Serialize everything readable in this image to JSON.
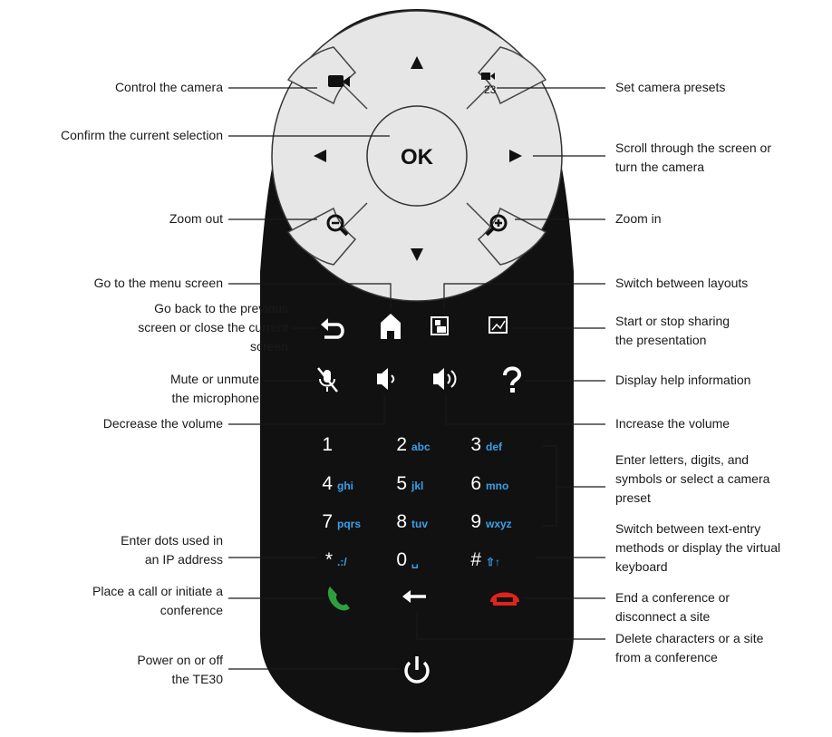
{
  "remote": {
    "ok_label": "OK",
    "power_label": "the TE30"
  },
  "keypad": {
    "keys": [
      {
        "digit": "1",
        "letters": ""
      },
      {
        "digit": "2",
        "letters": "abc"
      },
      {
        "digit": "3",
        "letters": "def"
      },
      {
        "digit": "4",
        "letters": "ghi"
      },
      {
        "digit": "5",
        "letters": "jkl"
      },
      {
        "digit": "6",
        "letters": "mno"
      },
      {
        "digit": "7",
        "letters": "pqrs"
      },
      {
        "digit": "8",
        "letters": "tuv"
      },
      {
        "digit": "9",
        "letters": "wxyz"
      },
      {
        "digit": "*",
        "letters": ".:/"
      },
      {
        "digit": "0",
        "letters": "␣"
      },
      {
        "digit": "#",
        "letters": "⇧↑"
      }
    ]
  },
  "callouts": {
    "control_camera": [
      "Control the camera"
    ],
    "confirm_selection": [
      "Confirm the current selection"
    ],
    "zoom_out": [
      "Zoom out"
    ],
    "menu_screen": [
      "Go to the menu screen"
    ],
    "go_back": [
      "Go back to the previous",
      "screen or close the current",
      "screen"
    ],
    "mute": [
      "Mute or unmute",
      "the microphone"
    ],
    "decrease_volume": [
      "Decrease the volume"
    ],
    "enter_dots": [
      "Enter dots used in",
      "an IP address"
    ],
    "place_call": [
      "Place a call or initiate a",
      "conference"
    ],
    "power": [
      "Power on or off",
      "the TE30"
    ],
    "camera_presets": [
      "Set camera presets"
    ],
    "scroll": [
      "Scroll through the screen or",
      "turn the camera"
    ],
    "zoom_in": [
      "Zoom in"
    ],
    "switch_layouts": [
      "Switch between layouts"
    ],
    "share_presentation": [
      "Start or stop sharing",
      "the presentation"
    ],
    "help": [
      "Display help information"
    ],
    "increase_volume": [
      "Increase the volume"
    ],
    "enter_letters": [
      "Enter letters, digits, and",
      "symbols or select a camera",
      "preset"
    ],
    "switch_text_entry": [
      "Switch between text-entry",
      "methods or display the virtual",
      "keyboard"
    ],
    "end_conference": [
      "End a conference or",
      "disconnect a site"
    ],
    "delete_chars": [
      "Delete characters or a site",
      "from a conference"
    ]
  },
  "colors": {
    "body": "#111111",
    "dpad": "#e6e6e6",
    "letters": "#3aa0e8",
    "call_green": "#2e9e3e",
    "end_red": "#e0231c"
  }
}
